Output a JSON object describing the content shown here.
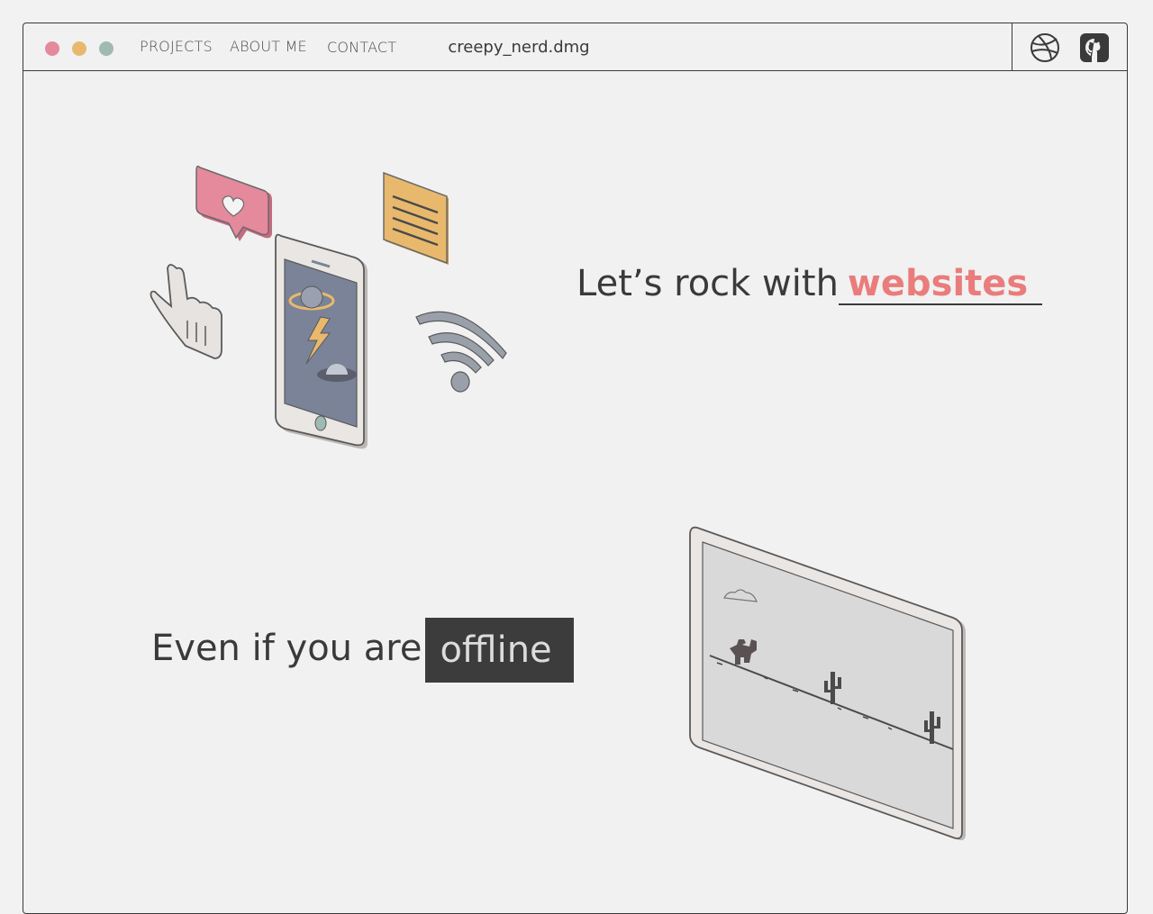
{
  "window": {
    "title": "creepy_nerd.dmg",
    "traffic_lights": [
      "#e5899d",
      "#e8b96d",
      "#9fbab3"
    ]
  },
  "nav": {
    "items": [
      {
        "label": "PROJECTS"
      },
      {
        "label": "ABOUT ME"
      },
      {
        "label": "CONTACT"
      }
    ]
  },
  "social": {
    "icons": [
      "dribbble-icon",
      "github-icon"
    ]
  },
  "hero": {
    "prefix": "Let’s rock with",
    "typed_word": "websites",
    "accent_color": "#ea7c7c"
  },
  "offline": {
    "prefix": "Even if you are",
    "highlight": "offline"
  },
  "illustrations": [
    "isometric-phone-illustration",
    "isometric-tablet-dino-game-illustration"
  ]
}
